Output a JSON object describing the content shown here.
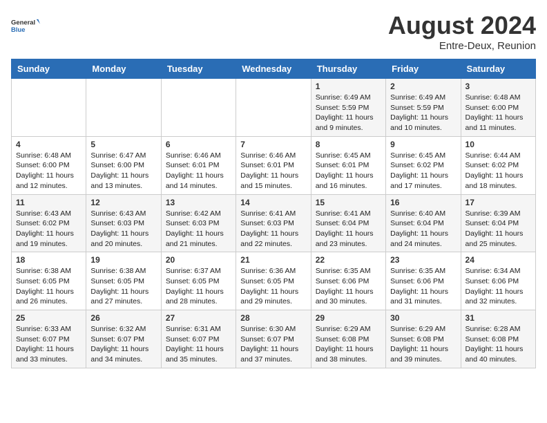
{
  "header": {
    "logo_general": "General",
    "logo_blue": "Blue",
    "title": "August 2024",
    "location": "Entre-Deux, Reunion"
  },
  "days_of_week": [
    "Sunday",
    "Monday",
    "Tuesday",
    "Wednesday",
    "Thursday",
    "Friday",
    "Saturday"
  ],
  "weeks": [
    [
      null,
      null,
      null,
      null,
      {
        "day": "1",
        "sunrise": "6:49 AM",
        "sunset": "5:59 PM",
        "daylight": "11 hours and 9 minutes."
      },
      {
        "day": "2",
        "sunrise": "6:49 AM",
        "sunset": "5:59 PM",
        "daylight": "11 hours and 10 minutes."
      },
      {
        "day": "3",
        "sunrise": "6:48 AM",
        "sunset": "6:00 PM",
        "daylight": "11 hours and 11 minutes."
      }
    ],
    [
      {
        "day": "4",
        "sunrise": "6:48 AM",
        "sunset": "6:00 PM",
        "daylight": "11 hours and 12 minutes."
      },
      {
        "day": "5",
        "sunrise": "6:47 AM",
        "sunset": "6:00 PM",
        "daylight": "11 hours and 13 minutes."
      },
      {
        "day": "6",
        "sunrise": "6:46 AM",
        "sunset": "6:01 PM",
        "daylight": "11 hours and 14 minutes."
      },
      {
        "day": "7",
        "sunrise": "6:46 AM",
        "sunset": "6:01 PM",
        "daylight": "11 hours and 15 minutes."
      },
      {
        "day": "8",
        "sunrise": "6:45 AM",
        "sunset": "6:01 PM",
        "daylight": "11 hours and 16 minutes."
      },
      {
        "day": "9",
        "sunrise": "6:45 AM",
        "sunset": "6:02 PM",
        "daylight": "11 hours and 17 minutes."
      },
      {
        "day": "10",
        "sunrise": "6:44 AM",
        "sunset": "6:02 PM",
        "daylight": "11 hours and 18 minutes."
      }
    ],
    [
      {
        "day": "11",
        "sunrise": "6:43 AM",
        "sunset": "6:02 PM",
        "daylight": "11 hours and 19 minutes."
      },
      {
        "day": "12",
        "sunrise": "6:43 AM",
        "sunset": "6:03 PM",
        "daylight": "11 hours and 20 minutes."
      },
      {
        "day": "13",
        "sunrise": "6:42 AM",
        "sunset": "6:03 PM",
        "daylight": "11 hours and 21 minutes."
      },
      {
        "day": "14",
        "sunrise": "6:41 AM",
        "sunset": "6:03 PM",
        "daylight": "11 hours and 22 minutes."
      },
      {
        "day": "15",
        "sunrise": "6:41 AM",
        "sunset": "6:04 PM",
        "daylight": "11 hours and 23 minutes."
      },
      {
        "day": "16",
        "sunrise": "6:40 AM",
        "sunset": "6:04 PM",
        "daylight": "11 hours and 24 minutes."
      },
      {
        "day": "17",
        "sunrise": "6:39 AM",
        "sunset": "6:04 PM",
        "daylight": "11 hours and 25 minutes."
      }
    ],
    [
      {
        "day": "18",
        "sunrise": "6:38 AM",
        "sunset": "6:05 PM",
        "daylight": "11 hours and 26 minutes."
      },
      {
        "day": "19",
        "sunrise": "6:38 AM",
        "sunset": "6:05 PM",
        "daylight": "11 hours and 27 minutes."
      },
      {
        "day": "20",
        "sunrise": "6:37 AM",
        "sunset": "6:05 PM",
        "daylight": "11 hours and 28 minutes."
      },
      {
        "day": "21",
        "sunrise": "6:36 AM",
        "sunset": "6:05 PM",
        "daylight": "11 hours and 29 minutes."
      },
      {
        "day": "22",
        "sunrise": "6:35 AM",
        "sunset": "6:06 PM",
        "daylight": "11 hours and 30 minutes."
      },
      {
        "day": "23",
        "sunrise": "6:35 AM",
        "sunset": "6:06 PM",
        "daylight": "11 hours and 31 minutes."
      },
      {
        "day": "24",
        "sunrise": "6:34 AM",
        "sunset": "6:06 PM",
        "daylight": "11 hours and 32 minutes."
      }
    ],
    [
      {
        "day": "25",
        "sunrise": "6:33 AM",
        "sunset": "6:07 PM",
        "daylight": "11 hours and 33 minutes."
      },
      {
        "day": "26",
        "sunrise": "6:32 AM",
        "sunset": "6:07 PM",
        "daylight": "11 hours and 34 minutes."
      },
      {
        "day": "27",
        "sunrise": "6:31 AM",
        "sunset": "6:07 PM",
        "daylight": "11 hours and 35 minutes."
      },
      {
        "day": "28",
        "sunrise": "6:30 AM",
        "sunset": "6:07 PM",
        "daylight": "11 hours and 37 minutes."
      },
      {
        "day": "29",
        "sunrise": "6:29 AM",
        "sunset": "6:08 PM",
        "daylight": "11 hours and 38 minutes."
      },
      {
        "day": "30",
        "sunrise": "6:29 AM",
        "sunset": "6:08 PM",
        "daylight": "11 hours and 39 minutes."
      },
      {
        "day": "31",
        "sunrise": "6:28 AM",
        "sunset": "6:08 PM",
        "daylight": "11 hours and 40 minutes."
      }
    ]
  ]
}
